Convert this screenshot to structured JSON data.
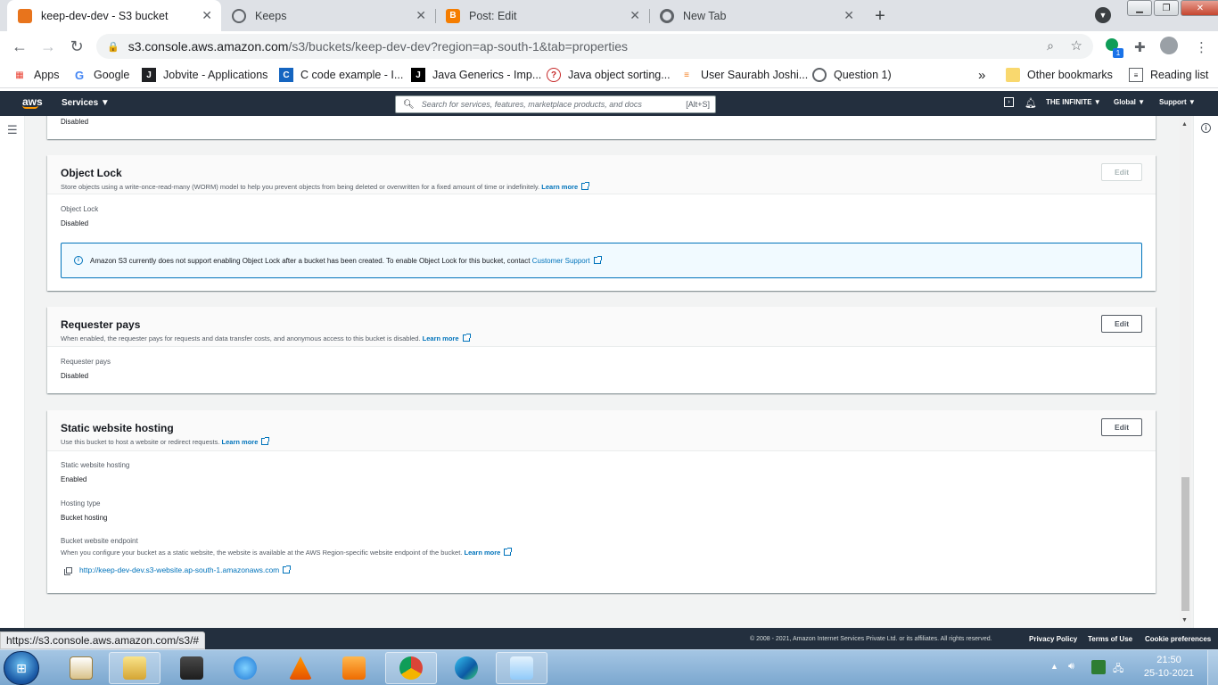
{
  "browser": {
    "tabs": [
      {
        "title": "keep-dev-dev - S3 bucket",
        "active": true
      },
      {
        "title": "Keeps",
        "active": false
      },
      {
        "title": "Post: Edit",
        "active": false
      },
      {
        "title": "New Tab",
        "active": false
      }
    ],
    "close_glyph": "✕",
    "new_tab_glyph": "+",
    "url_host": "s3.console.aws.amazon.com",
    "url_path": "/s3/buckets/keep-dev-dev?region=ap-south-1&tab=properties",
    "extension_badge": "1",
    "bookmarks": [
      {
        "label": "Apps"
      },
      {
        "label": "Google"
      },
      {
        "label": "Jobvite - Applications"
      },
      {
        "label": "C code example - I..."
      },
      {
        "label": "Java Generics - Imp..."
      },
      {
        "label": "Java object sorting..."
      },
      {
        "label": "User Saurabh Joshi..."
      },
      {
        "label": "Question 1)"
      }
    ],
    "overflow_glyph": "»",
    "other_bookmarks": "Other bookmarks",
    "reading_list": "Reading list",
    "status_url": "https://s3.console.aws.amazon.com/s3/#"
  },
  "aws_nav": {
    "logo": "aws",
    "services": "Services ▼",
    "search_placeholder": "Search for services, features, marketplace products, and docs",
    "search_shortcut": "[Alt+S]",
    "account": "THE INFINITE ▼",
    "region": "Global ▼",
    "support": "Support ▼"
  },
  "content": {
    "top_partial_value": "Disabled",
    "object_lock": {
      "title": "Object Lock",
      "description": "Store objects using a write-once-read-many (WORM) model to help you prevent objects from being deleted or overwritten for a fixed amount of time or indefinitely.",
      "learn_more": "Learn more",
      "edit": "Edit",
      "field_label": "Object Lock",
      "field_value": "Disabled",
      "alert_text": "Amazon S3 currently does not support enabling Object Lock after a bucket has been created. To enable Object Lock for this bucket, contact",
      "alert_link": "Customer Support"
    },
    "requester_pays": {
      "title": "Requester pays",
      "description": "When enabled, the requester pays for requests and data transfer costs, and anonymous access to this bucket is disabled.",
      "learn_more": "Learn more",
      "edit": "Edit",
      "field_label": "Requester pays",
      "field_value": "Disabled"
    },
    "static_website": {
      "title": "Static website hosting",
      "description": "Use this bucket to host a website or redirect requests.",
      "learn_more": "Learn more",
      "edit": "Edit",
      "hosting_label": "Static website hosting",
      "hosting_value": "Enabled",
      "type_label": "Hosting type",
      "type_value": "Bucket hosting",
      "endpoint_label": "Bucket website endpoint",
      "endpoint_desc": "When you configure your bucket as a static website, the website is available at the AWS Region-specific website endpoint of the bucket.",
      "endpoint_learn_more": "Learn more",
      "endpoint_url": "http://keep-dev-dev.s3-website.ap-south-1.amazonaws.com"
    }
  },
  "footer": {
    "copyright": "© 2008 - 2021, Amazon Internet Services Private Ltd. or its affiliates. All rights reserved.",
    "privacy": "Privacy Policy",
    "terms": "Terms of Use",
    "cookies": "Cookie preferences"
  },
  "taskbar": {
    "time": "21:50",
    "date": "25-10-2021"
  },
  "colors": {
    "aws_nav": "#232f3e",
    "aws_orange": "#ff9900",
    "link": "#0073bb"
  }
}
